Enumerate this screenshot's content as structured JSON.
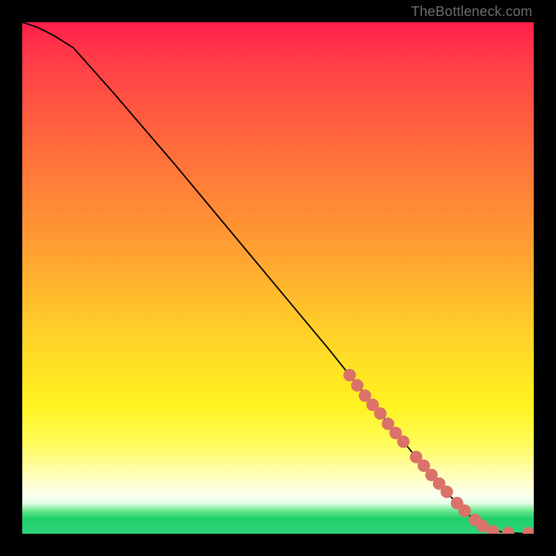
{
  "attribution": "TheBottleneck.com",
  "chart_data": {
    "type": "line",
    "title": "",
    "xlabel": "",
    "ylabel": "",
    "xlim": [
      0,
      100
    ],
    "ylim": [
      0,
      100
    ],
    "series": [
      {
        "name": "curve",
        "x": [
          0,
          3,
          6,
          10,
          18,
          30,
          45,
          60,
          72,
          82,
          88,
          91,
          94,
          97,
          100
        ],
        "y": [
          100,
          99,
          97.5,
          95,
          86,
          72,
          54,
          36,
          21,
          9,
          3,
          1,
          0.3,
          0.1,
          0.1
        ]
      }
    ],
    "markers": {
      "name": "highlighted-points",
      "color": "#da7269",
      "radius_px": 9,
      "points": [
        {
          "x": 64,
          "y": 31
        },
        {
          "x": 65.5,
          "y": 29
        },
        {
          "x": 67,
          "y": 27
        },
        {
          "x": 68.5,
          "y": 25.2
        },
        {
          "x": 70,
          "y": 23.5
        },
        {
          "x": 71.5,
          "y": 21.5
        },
        {
          "x": 73,
          "y": 19.7
        },
        {
          "x": 74.5,
          "y": 18
        },
        {
          "x": 77,
          "y": 15
        },
        {
          "x": 78.5,
          "y": 13.3
        },
        {
          "x": 80,
          "y": 11.5
        },
        {
          "x": 81.5,
          "y": 9.8
        },
        {
          "x": 83,
          "y": 8.2
        },
        {
          "x": 85,
          "y": 6
        },
        {
          "x": 86.5,
          "y": 4.5
        },
        {
          "x": 88.5,
          "y": 2.7
        },
        {
          "x": 90,
          "y": 1.5
        },
        {
          "x": 92,
          "y": 0.5
        },
        {
          "x": 95,
          "y": 0.15
        },
        {
          "x": 99,
          "y": 0.1
        }
      ]
    }
  }
}
